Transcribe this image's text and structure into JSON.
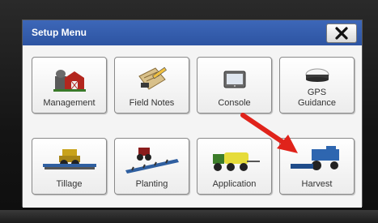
{
  "setup_menu": {
    "title": "Setup Menu",
    "close_icon": "close-icon"
  },
  "tiles": [
    {
      "label": "Management",
      "icon": "barn-icon"
    },
    {
      "label": "Field Notes",
      "icon": "notepad-pencil-icon"
    },
    {
      "label": "Console",
      "icon": "monitor-icon"
    },
    {
      "label": "GPS Guidance",
      "label_line1": "GPS",
      "label_line2": "Guidance",
      "icon": "gps-receiver-icon"
    },
    {
      "label": "Tillage",
      "icon": "tillage-icon"
    },
    {
      "label": "Planting",
      "icon": "planter-icon"
    },
    {
      "label": "Application",
      "icon": "sprayer-icon"
    },
    {
      "label": "Harvest",
      "icon": "combine-icon"
    }
  ],
  "colors": {
    "titlebar": "#2f57a6",
    "annotation_arrow": "#e0231b"
  }
}
